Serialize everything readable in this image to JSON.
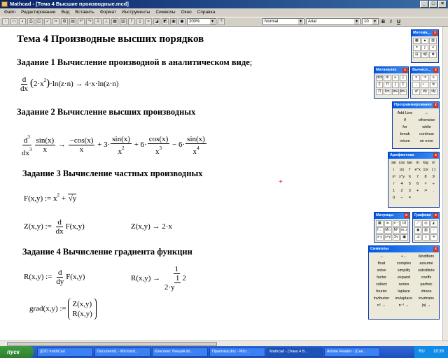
{
  "window": {
    "title": "Mathcad - [Тема 4 Высшие производные.mcd]"
  },
  "menu": [
    "Файл",
    "Редактирование",
    "Вид",
    "Вставить",
    "Формат",
    "Инструменты",
    "Символы",
    "Окно",
    "Справка"
  ],
  "toolbar": {
    "zoom": "200%",
    "style": "Normal",
    "font": "Arial",
    "size": "10",
    "bold": "B",
    "italic": "I",
    "underline": "U"
  },
  "doc": {
    "title": "Тема 4 Производные высших порядков",
    "task1": "Задание 1 Вычисление производной в аналитическом виде",
    "task1_punct": ";",
    "task2": "Задание 2 Вычисление высших производных",
    "task3": "Задание 3 Вычисление частных производных",
    "task4": "Задание 4 Вычисление градиента функции"
  },
  "palettes": {
    "math": {
      "title": "Матема..."
    },
    "calculus": {
      "title": "Матанализ"
    },
    "eval": {
      "title": "Вычисл...",
      "items": [
        "=",
        ":=",
        "≡",
        "→",
        "•→",
        "fx",
        "xf",
        "xfy",
        "xfy"
      ]
    },
    "programming": {
      "title": "Программирование",
      "items": [
        "Add Line",
        "←",
        "if",
        "otherwise",
        "for",
        "while",
        "break",
        "continue",
        "return",
        "on error"
      ]
    },
    "arithmetic": {
      "title": "Арифметика",
      "items": [
        "sin",
        "cos",
        "tan",
        "ln",
        "log",
        "n!",
        "i",
        "|x|",
        "Γ",
        "e^x",
        "1/x",
        "( )",
        "x²",
        "x^y",
        "π",
        "7",
        "8",
        "9",
        "/",
        "4",
        "5",
        "6",
        "×",
        "÷",
        "1",
        "2",
        "3",
        "+",
        ":=",
        ".",
        "0",
        "−",
        "="
      ]
    },
    "matrix": {
      "title": "Матрицы"
    },
    "graph": {
      "title": "Графики"
    },
    "symbolic": {
      "title": "Символы",
      "items": [
        "→",
        "•→",
        "Modifiers",
        "float",
        "complex",
        "assume",
        "solve",
        "simplify",
        "substitute",
        "factor",
        "expand",
        "coeffs",
        "collect",
        "series",
        "parfrac",
        "fourier",
        "laplace",
        "ztrans",
        "invfourier",
        "invlaplace",
        "invztrans",
        "n² →",
        "n⁻¹ →",
        "|n| →"
      ]
    }
  },
  "taskbar": {
    "start": "пуск",
    "tasks": [
      "ДПО mathCad",
      "Document1 - Microsof...",
      "Конспект Лекций.do...",
      "Практика.doc - Micr...",
      "Mathcad - [Тема 4 В...",
      "Adobe Reader - [Сек..."
    ],
    "lang": "RU",
    "time": "18:39"
  }
}
